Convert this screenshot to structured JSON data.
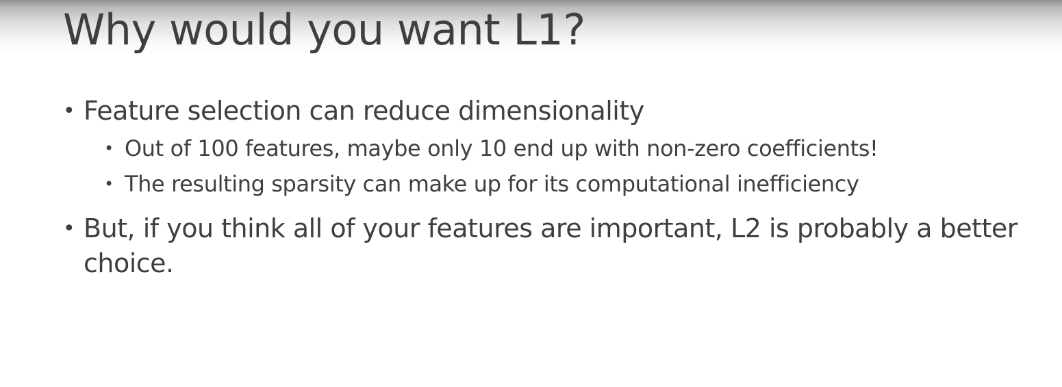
{
  "slide": {
    "title": "Why would you want L1?",
    "bullets": [
      {
        "text": "Feature selection can reduce dimensionality",
        "sub": [
          "Out of 100 features, maybe only 10 end up with non-zero coefficients!",
          "The resulting sparsity can make up for its computational inefficiency"
        ]
      },
      {
        "text": "But, if you think all of your features are important, L2 is probably a better choice.",
        "sub": []
      }
    ],
    "bullet_glyph": "•"
  }
}
